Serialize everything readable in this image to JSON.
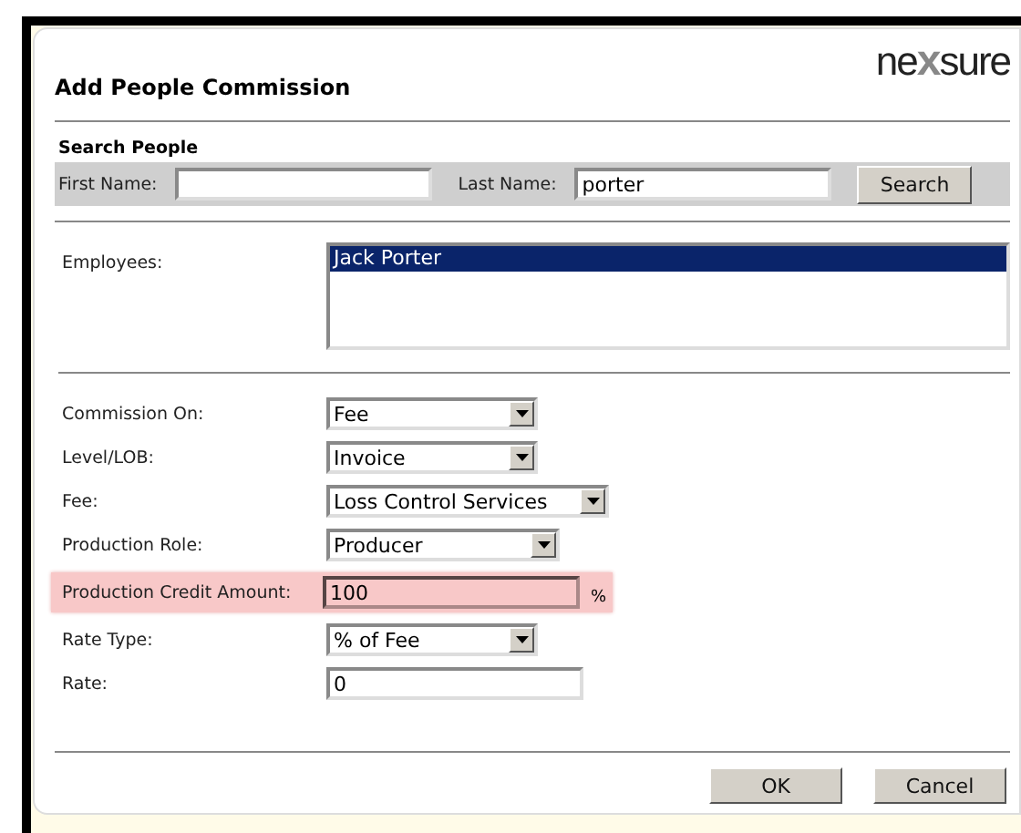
{
  "dialog": {
    "title": "Add People Commission",
    "logo": "ne**x**sure"
  },
  "search": {
    "heading": "Search People",
    "first_name": {
      "label": "First Name:"
    },
    "last_name": {
      "label": "Last Name:",
      "value": "porter"
    },
    "button": "Search"
  },
  "employees": {
    "label": "Employees:",
    "items": [
      {
        "name": "Jack Porter",
        "selected": true
      }
    ]
  },
  "fields": [
    {
      "kind": "select",
      "label": "Commission On:",
      "value": "Fee",
      "highlighted": false
    },
    {
      "kind": "select",
      "label": "Level/LOB:",
      "value": "Invoice",
      "highlighted": false
    },
    {
      "kind": "select",
      "label": "Fee:",
      "value": "Loss Control Services",
      "highlighted": false
    },
    {
      "kind": "select",
      "label": "Production Role:",
      "value": "Producer",
      "highlighted": false
    },
    {
      "kind": "text",
      "label": "Production Credit Amount:",
      "value": "100",
      "suffix": "%",
      "highlighted": true
    },
    {
      "kind": "select",
      "label": "Rate Type:",
      "value": "% of Fee",
      "highlighted": false
    },
    {
      "kind": "text",
      "label": "Rate:",
      "value": "0",
      "highlighted": false
    }
  ],
  "buttons": [
    "OK",
    "Cancel"
  ]
}
